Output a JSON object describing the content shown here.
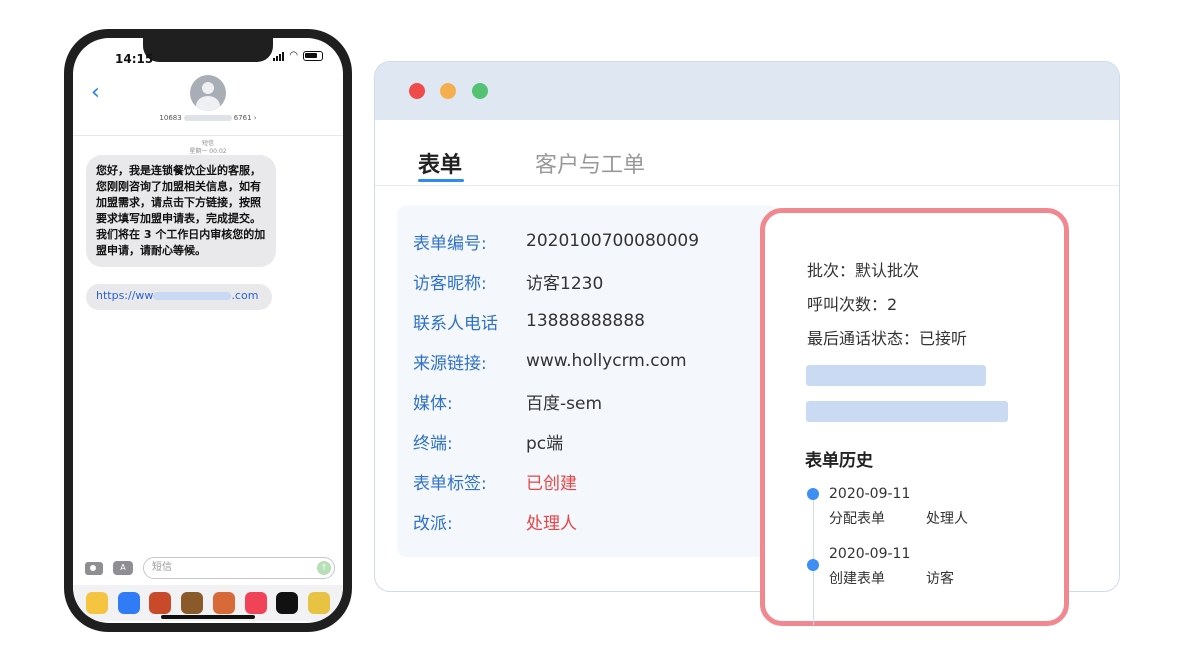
{
  "phone": {
    "status_time": "14:15",
    "sender_prefix": "10683",
    "sender_suffix": "6761",
    "meta_type": "短信",
    "meta_time": "星期一 00:02",
    "message": "您好，我是连锁餐饮企业的客服，您刚刚咨询了加盟相关信息，如有加盟需求，请点击下方链接，按照要求填写加盟申请表，完成提交。我们将在 3 个工作日内审核您的加盟申请，请耐心等候。",
    "link_prefix": "https://ww",
    "link_suffix": ".com",
    "input_placeholder": "短信",
    "dock_colors": [
      "#f5c542",
      "#2f7cf6",
      "#c94a2b",
      "#8a5a2b",
      "#d86a3a",
      "#f04357",
      "#111111",
      "#e8c343"
    ]
  },
  "window": {
    "tabs": [
      {
        "label": "表单",
        "active": true
      },
      {
        "label": "客户与工单",
        "active": false
      }
    ],
    "form": {
      "fields": [
        {
          "label": "表单编号:",
          "value": "2020100700080009"
        },
        {
          "label": "访客昵称:",
          "value": "访客1230"
        },
        {
          "label": "联系人电话",
          "value": "13888888888"
        },
        {
          "label": "来源链接:",
          "value": "www.hollycrm.com"
        },
        {
          "label": "媒体:",
          "value": "百度-sem"
        },
        {
          "label": "终端:",
          "value": "pc端"
        },
        {
          "label": "表单标签:",
          "value": "已创建"
        },
        {
          "label": "改派:",
          "value": "处理人"
        }
      ]
    }
  },
  "panel": {
    "batch": "批次：默认批次",
    "call_count": "呼叫次数：2",
    "last_call_status": "最后通话状态：已接听",
    "history_title": "表单历史",
    "history": [
      {
        "date": "2020-09-11",
        "action": "分配表单",
        "actor": "处理人"
      },
      {
        "date": "2020-09-11",
        "action": "创建表单",
        "actor": "访客"
      }
    ]
  },
  "colors": {
    "accent_blue": "#2d8cf0",
    "label_blue": "#2f72c8",
    "alert_red": "#e64646",
    "panel_border": "#f1888f"
  }
}
